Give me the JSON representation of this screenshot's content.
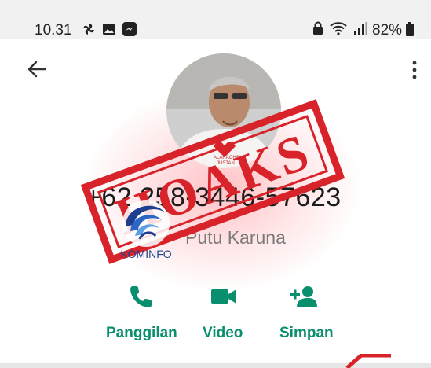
{
  "status_bar": {
    "time": "10.31",
    "battery": "82%",
    "left_icons": [
      "fan-icon",
      "image-icon",
      "messenger-icon"
    ],
    "right_icons": [
      "lock-icon",
      "wifi-icon",
      "signal-icon",
      "battery-icon"
    ]
  },
  "toolbar": {
    "back_icon": "arrow-left-icon",
    "menu_icon": "more-vertical-icon"
  },
  "contact": {
    "phone_number": "+62 258-3446-57623",
    "name": "Putu Karuna"
  },
  "overlays": {
    "stamp_text": "HOAKS",
    "logo_text": "KOMINFO",
    "shirt_text_1": "ALARAOHS",
    "shirt_text_2": "JUSTAN"
  },
  "actions": [
    {
      "label": "Panggilan",
      "icon": "phone-icon"
    },
    {
      "label": "Video",
      "icon": "videocam-icon"
    },
    {
      "label": "Simpan",
      "icon": "person-add-icon"
    }
  ],
  "colors": {
    "accent": "#0a8f6e",
    "stamp_red": "#d8232a",
    "logo_blue": "#1e3f8f"
  }
}
